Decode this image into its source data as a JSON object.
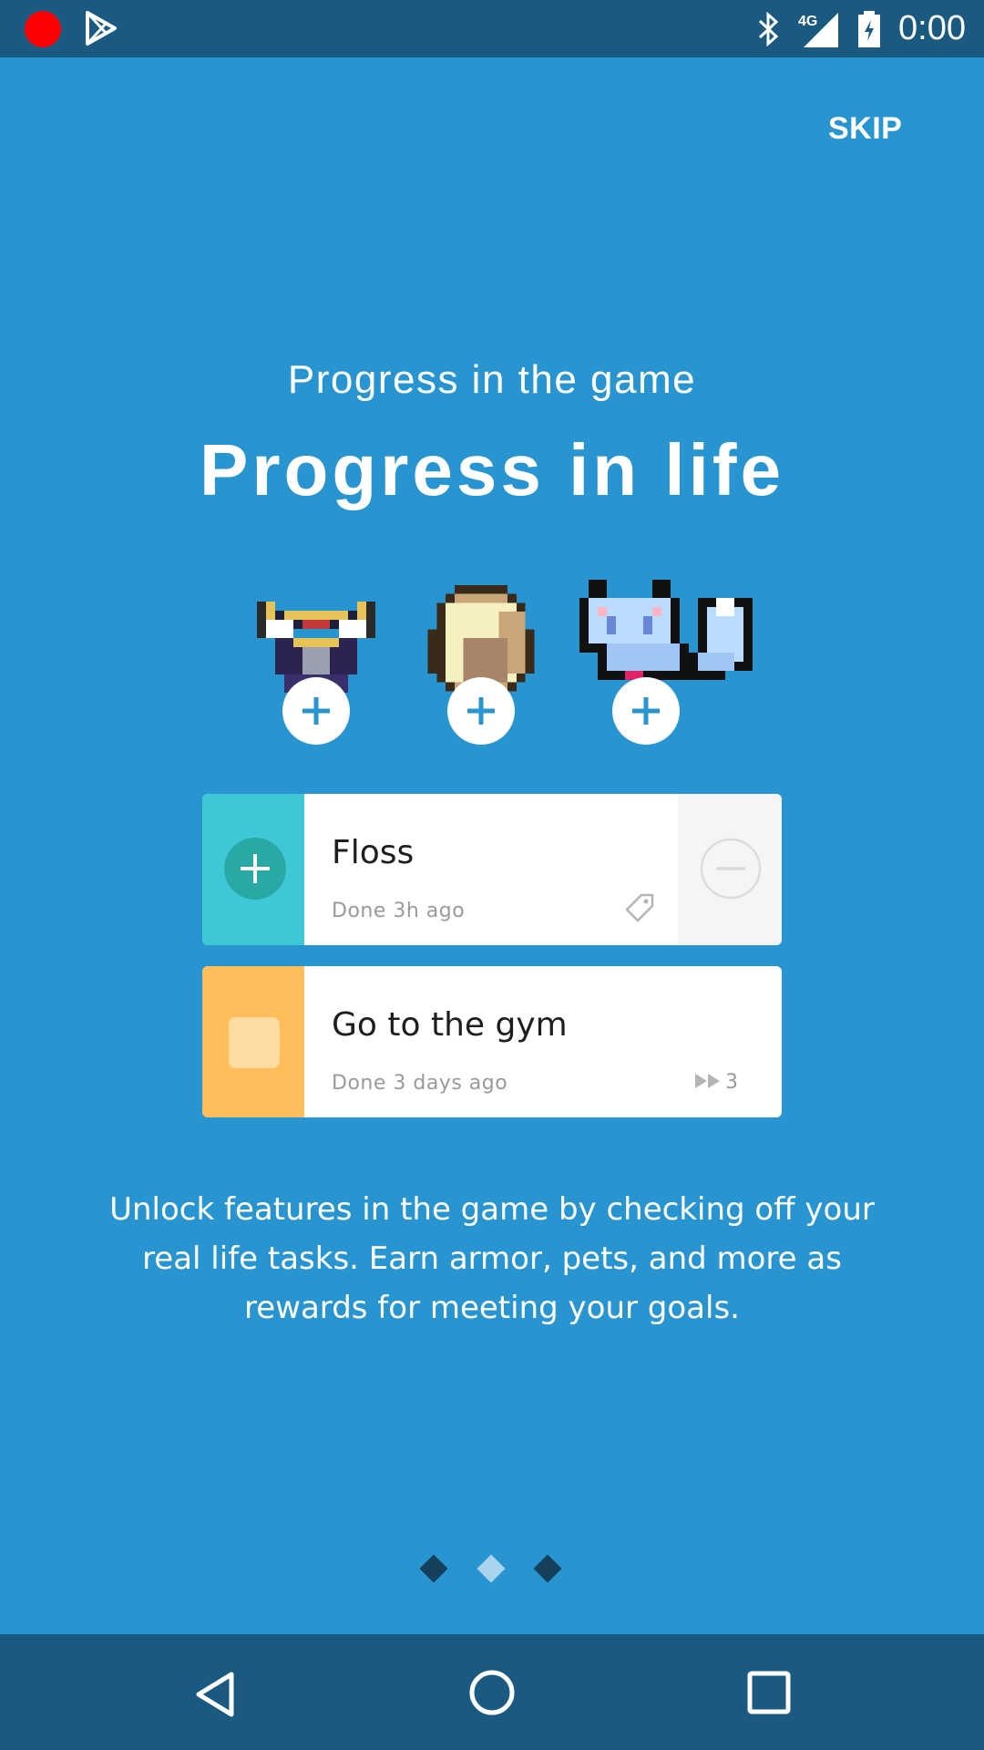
{
  "status_bar": {
    "time": "0:00",
    "network": "4G",
    "icons": [
      "record-icon",
      "play-store-icon",
      "bluetooth-icon",
      "signal-icon",
      "battery-charging-icon"
    ]
  },
  "header": {
    "skip_label": "SKIP"
  },
  "hero": {
    "subtitle": "Progress in the game",
    "title": "Progress in life"
  },
  "avatars": [
    {
      "name": "armor-sprite"
    },
    {
      "name": "egg-sprite"
    },
    {
      "name": "cat-pet-sprite"
    }
  ],
  "tasks": [
    {
      "title": "Floss",
      "note": "Done 3h ago",
      "color": "#3ec8d6",
      "icon": "tag-icon"
    },
    {
      "title": "Go to the gym",
      "note": "Done 3 days ago",
      "color": "#ffbe5c",
      "streak": "3",
      "icon": "fast-forward-icon"
    }
  ],
  "description": "Unlock features in the game by checking off your real life tasks. Earn armor, pets, and more as rewards for meeting your goals.",
  "pager": {
    "count": 3,
    "active": 1
  },
  "colors": {
    "background": "#2995d0",
    "bars": "#1a5a80",
    "dot_active": "#a9d4ef",
    "dot_inactive": "#14405e"
  }
}
